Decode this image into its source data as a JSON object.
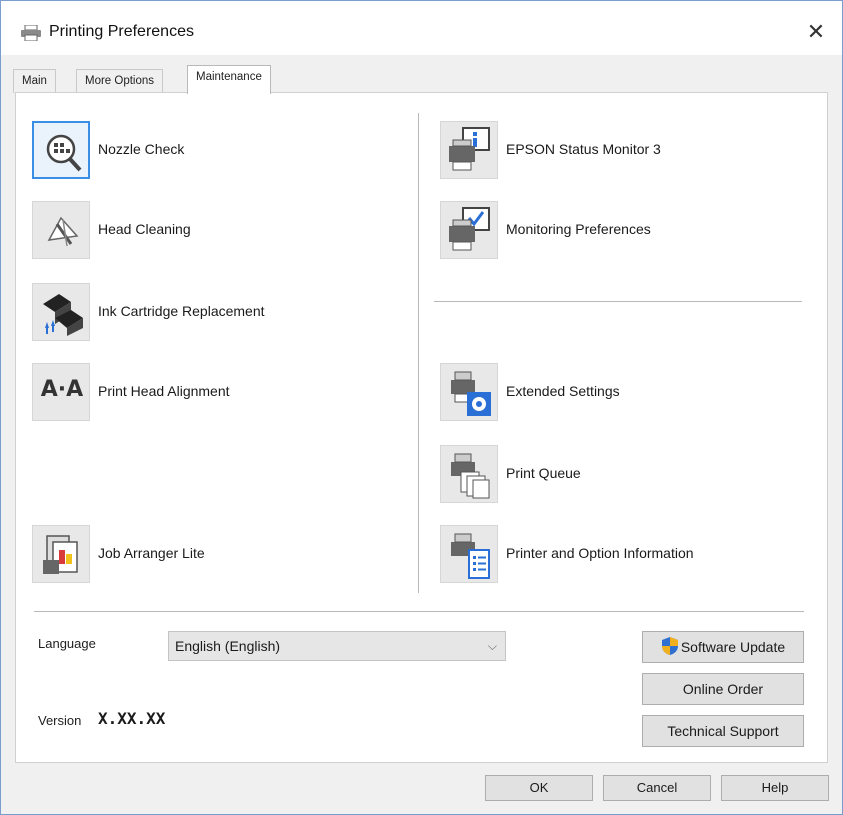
{
  "window": {
    "title": "Printing Preferences",
    "close_glyph": "✕",
    "title_icon": "printer-icon"
  },
  "tabs": [
    {
      "label": "Main",
      "active": false
    },
    {
      "label": "More Options",
      "active": false
    },
    {
      "label": "Maintenance",
      "active": true
    }
  ],
  "left_items": [
    {
      "label": "Nozzle Check",
      "icon": "nozzle-check-icon",
      "selected": true
    },
    {
      "label": "Head Cleaning",
      "icon": "head-cleaning-icon"
    },
    {
      "label": "Ink Cartridge Replacement",
      "icon": "ink-cartridge-icon"
    },
    {
      "label": "Print Head Alignment",
      "icon": "head-alignment-icon",
      "glyph": "A·A"
    },
    {
      "label": "Job Arranger Lite",
      "icon": "job-arranger-icon"
    }
  ],
  "right_items": [
    {
      "label": "EPSON Status Monitor 3",
      "icon": "status-monitor-icon"
    },
    {
      "label": "Monitoring Preferences",
      "icon": "monitoring-preferences-icon"
    },
    {
      "label": "Extended Settings",
      "icon": "extended-settings-icon"
    },
    {
      "label": "Print Queue",
      "icon": "print-queue-icon"
    },
    {
      "label": "Printer and Option Information",
      "icon": "printer-info-icon"
    }
  ],
  "language": {
    "label": "Language",
    "value": "English (English)",
    "chevron": "⌵"
  },
  "version": {
    "label": "Version",
    "value": "X.XX.XX"
  },
  "side_buttons": {
    "software_update": "Software Update",
    "online_order": "Online Order",
    "technical_support": "Technical Support"
  },
  "bottom_buttons": {
    "ok": "OK",
    "cancel": "Cancel",
    "help": "Help"
  },
  "colors": {
    "accent": "#3a8ee6",
    "window_border": "#7a9ccf",
    "shield_blue": "#2f6fd0",
    "shield_gold": "#f2b01e"
  }
}
